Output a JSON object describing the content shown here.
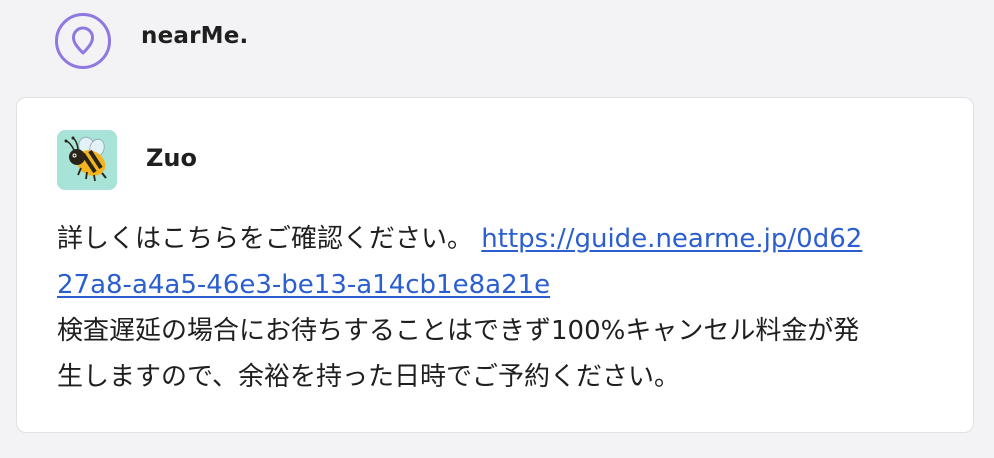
{
  "header": {
    "app_name": "nearMe."
  },
  "message": {
    "sender": "Zuo",
    "avatar_icon": "bee-icon",
    "line1_prefix": "詳しくはこちらをご確認ください。",
    "link_part1": "https://guide.nearme.jp/0d62",
    "link_part2": "27a8-a4a5-46e3-be13-a14cb1e8a21e",
    "line3": "検査遅延の場合にお待ちすることはできず100%キャンセル料金が発",
    "line4": "生しますので、余裕を持った日時でご予約ください。"
  },
  "colors": {
    "background": "#f3f2f5",
    "card": "#ffffff",
    "logo_purple": "#8f78e0",
    "link_blue": "#2b5fcf",
    "avatar_bg": "#a7e3d7"
  }
}
